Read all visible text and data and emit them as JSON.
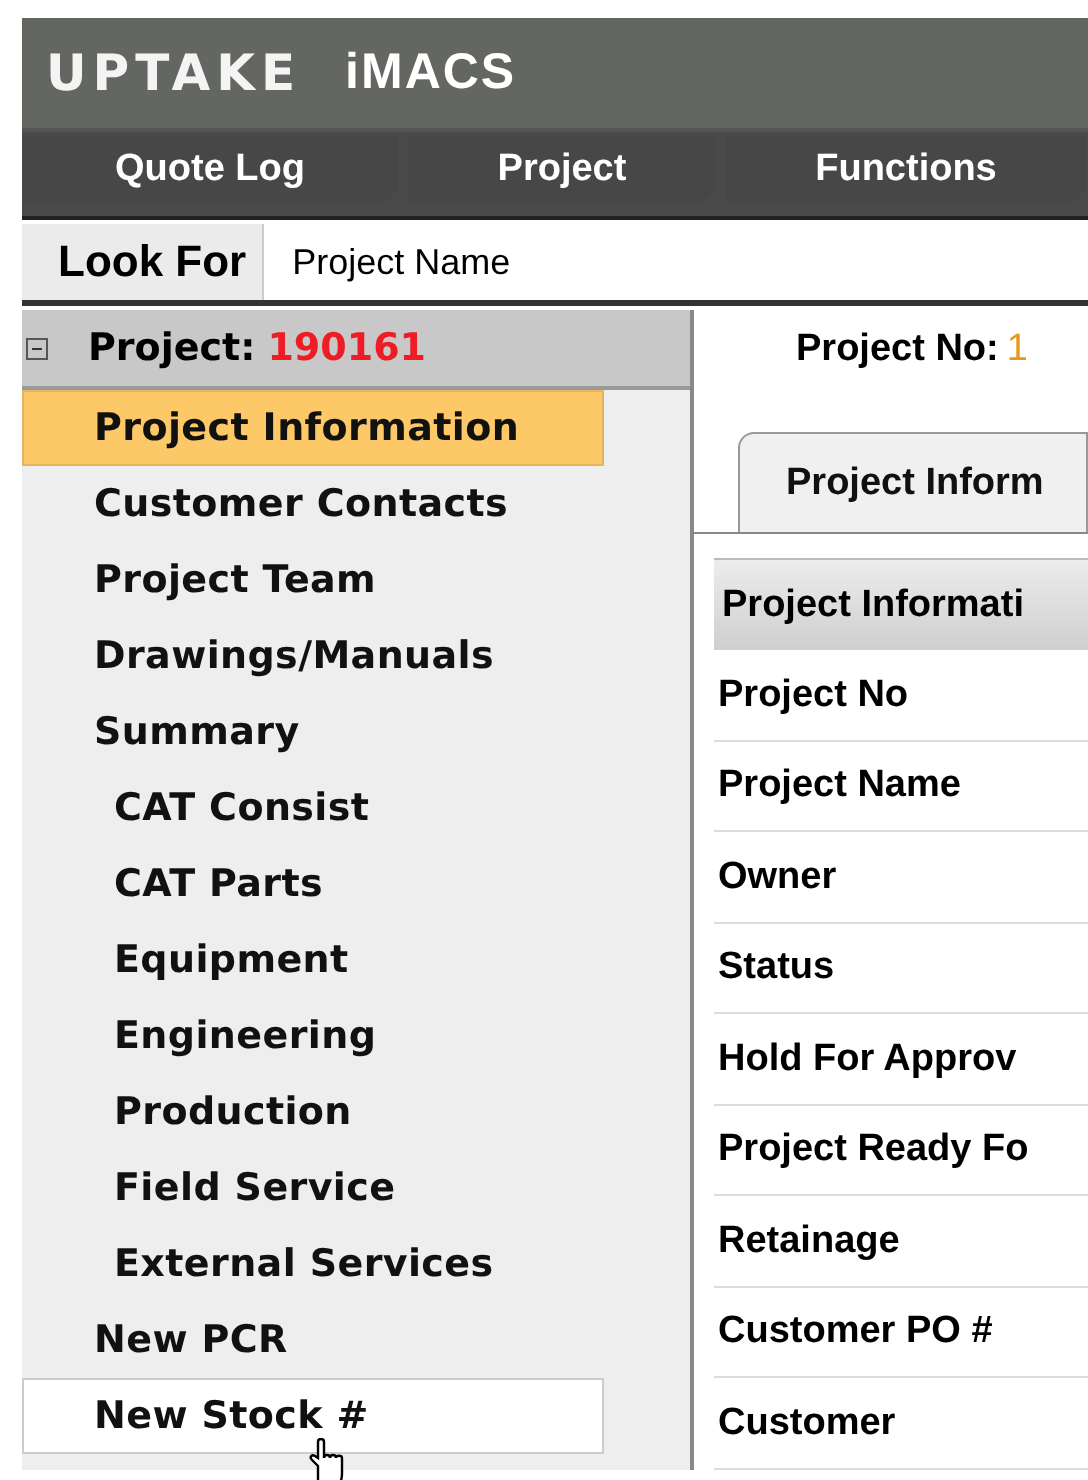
{
  "app": {
    "logo": "UPTAKE",
    "title": "iMACS"
  },
  "nav": [
    {
      "label": "Quote Log",
      "selected": false
    },
    {
      "label": "Project",
      "selected": false
    },
    {
      "label": "Functions",
      "selected": false
    }
  ],
  "look_for": {
    "label": "Look For",
    "value": "Project Name"
  },
  "tree": {
    "label": "Project:",
    "value": "190161",
    "expanded": true,
    "items": [
      {
        "label": "Project Information",
        "selected": true,
        "hovered": false
      },
      {
        "label": "Customer Contacts",
        "selected": false,
        "hovered": false
      },
      {
        "label": "Project Team",
        "selected": false,
        "hovered": false
      },
      {
        "label": "Drawings/Manuals",
        "selected": false,
        "hovered": false
      },
      {
        "label": "Summary",
        "selected": false,
        "hovered": false,
        "children": [
          {
            "label": "CAT Consist",
            "selected": false,
            "hovered": false
          },
          {
            "label": "CAT Parts",
            "selected": false,
            "hovered": false
          },
          {
            "label": "Equipment",
            "selected": false,
            "hovered": false
          },
          {
            "label": "Engineering",
            "selected": false,
            "hovered": false
          },
          {
            "label": "Production",
            "selected": false,
            "hovered": false
          },
          {
            "label": "Field Service",
            "selected": false,
            "hovered": false
          },
          {
            "label": "External Services",
            "selected": false,
            "hovered": false
          }
        ]
      },
      {
        "label": "New PCR",
        "selected": false,
        "hovered": false
      },
      {
        "label": "New Stock #",
        "selected": false,
        "hovered": true
      }
    ]
  },
  "detail": {
    "project_no": {
      "label": "Project No:",
      "value": "1"
    },
    "tabs": [
      {
        "label": "Project Inform",
        "selected": true
      }
    ],
    "table": {
      "header": "Project Informati",
      "rows": [
        "Project No",
        "Project Name",
        "Owner",
        "Status",
        "Hold For Approv",
        "Project Ready Fo",
        "Retainage",
        "Customer PO #",
        "Customer"
      ]
    }
  }
}
